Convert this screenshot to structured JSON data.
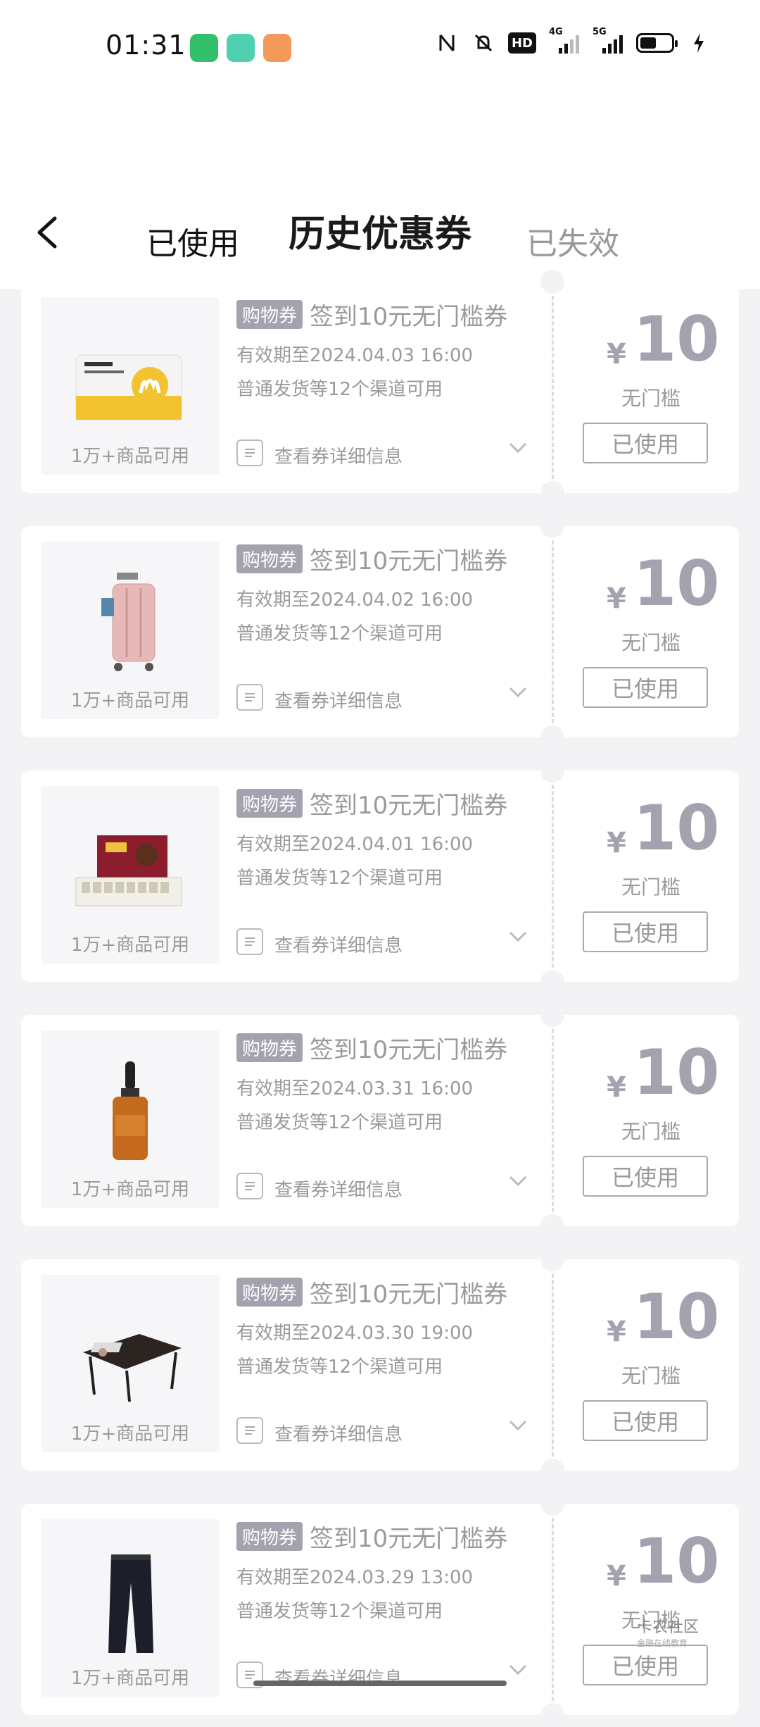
{
  "status_bar": {
    "time": "01:31",
    "icons": [
      "nfc-icon",
      "mute-icon",
      "hd-icon",
      "4g-signal-icon",
      "5g-signal-icon",
      "battery-icon",
      "charging-icon"
    ],
    "hd_label": "HD",
    "net_4g": "4G",
    "net_5g": "5G"
  },
  "header": {
    "title": "历史优惠券",
    "tabs": [
      {
        "label": "已使用",
        "active": true
      },
      {
        "label": "已失效",
        "active": false
      }
    ]
  },
  "coupons": [
    {
      "thumb": "mcdonalds-card",
      "thumb_caption": "1万+商品可用",
      "tag": "购物券",
      "name": "签到10元无门槛券",
      "validity": "有效期至2024.04.03 16:00",
      "channels": "普通发货等12个渠道可用",
      "detail": "查看券详细信息",
      "currency": "¥",
      "amount": "10",
      "threshold": "无门槛",
      "status": "已使用"
    },
    {
      "thumb": "suitcase",
      "thumb_caption": "1万+商品可用",
      "tag": "购物券",
      "name": "签到10元无门槛券",
      "validity": "有效期至2024.04.02 16:00",
      "channels": "普通发货等12个渠道可用",
      "detail": "查看券详细信息",
      "currency": "¥",
      "amount": "10",
      "threshold": "无门槛",
      "status": "已使用"
    },
    {
      "thumb": "mahjong-set",
      "thumb_caption": "1万+商品可用",
      "tag": "购物券",
      "name": "签到10元无门槛券",
      "validity": "有效期至2024.04.01 16:00",
      "channels": "普通发货等12个渠道可用",
      "detail": "查看券详细信息",
      "currency": "¥",
      "amount": "10",
      "threshold": "无门槛",
      "status": "已使用"
    },
    {
      "thumb": "serum-bottle",
      "thumb_caption": "1万+商品可用",
      "tag": "购物券",
      "name": "签到10元无门槛券",
      "validity": "有效期至2024.03.31 16:00",
      "channels": "普通发货等12个渠道可用",
      "detail": "查看券详细信息",
      "currency": "¥",
      "amount": "10",
      "threshold": "无门槛",
      "status": "已使用"
    },
    {
      "thumb": "bed-table",
      "thumb_caption": "1万+商品可用",
      "tag": "购物券",
      "name": "签到10元无门槛券",
      "validity": "有效期至2024.03.30 19:00",
      "channels": "普通发货等12个渠道可用",
      "detail": "查看券详细信息",
      "currency": "¥",
      "amount": "10",
      "threshold": "无门槛",
      "status": "已使用"
    },
    {
      "thumb": "pants",
      "thumb_caption": "1万+商品可用",
      "tag": "购物券",
      "name": "签到10元无门槛券",
      "validity": "有效期至2024.03.29 13:00",
      "channels": "普通发货等12个渠道可用",
      "detail": "查看券详细信息",
      "currency": "¥",
      "amount": "10",
      "threshold": "无门槛",
      "status": "已使用"
    }
  ],
  "watermark": {
    "title": "卡农社区",
    "subtitle": "金融在线教育"
  },
  "colors": {
    "accent_gray": "#a3a3b0",
    "background": "#f3f3f6",
    "card": "#ffffff",
    "text_muted": "#9a9a9a"
  }
}
